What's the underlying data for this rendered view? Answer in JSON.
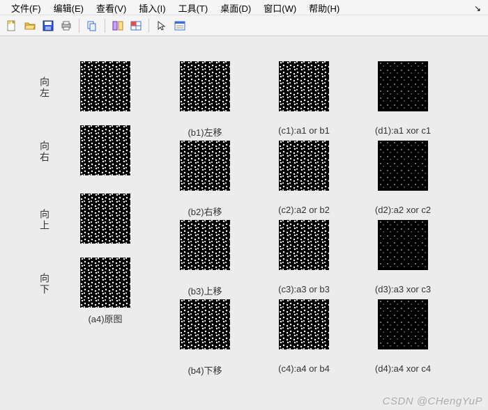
{
  "menubar": {
    "items": [
      {
        "label": "文件(F)"
      },
      {
        "label": "编辑(E)"
      },
      {
        "label": "查看(V)"
      },
      {
        "label": "插入(I)"
      },
      {
        "label": "工具(T)"
      },
      {
        "label": "桌面(D)"
      },
      {
        "label": "窗口(W)"
      },
      {
        "label": "帮助(H)"
      }
    ],
    "overflow_glyph": "↘"
  },
  "toolbar": {
    "new_icon": "new-file-icon",
    "open_icon": "open-folder-icon",
    "save_icon": "save-icon",
    "print_icon": "print-icon",
    "copy_icon": "copy-icon",
    "panel1_icon": "panel-split-icon",
    "panel2_icon": "panel-grid-icon",
    "pointer_icon": "pointer-icon",
    "window_icon": "window-list-icon"
  },
  "left_labels": {
    "l1": "向左",
    "l2": "向右",
    "l3": "向上",
    "l4": "向下"
  },
  "captions": {
    "a4": "(a4)原图",
    "b1": "(b1)左移",
    "b2": "(b2)右移",
    "b3": "(b3)上移",
    "b4": "(b4)下移",
    "c1": "(c1):a1 or b1",
    "c2": "(c2):a2 or b2",
    "c3": "(c3):a3 or b3",
    "c4": "(c4):a4 or b4",
    "d1": "(d1):a1 xor c1",
    "d2": "(d2):a2 xor c2",
    "d3": "(d3):a3 xor c3",
    "d4": "(d4):a4 xor c4"
  },
  "watermark": "CSDN @CHengYuP"
}
